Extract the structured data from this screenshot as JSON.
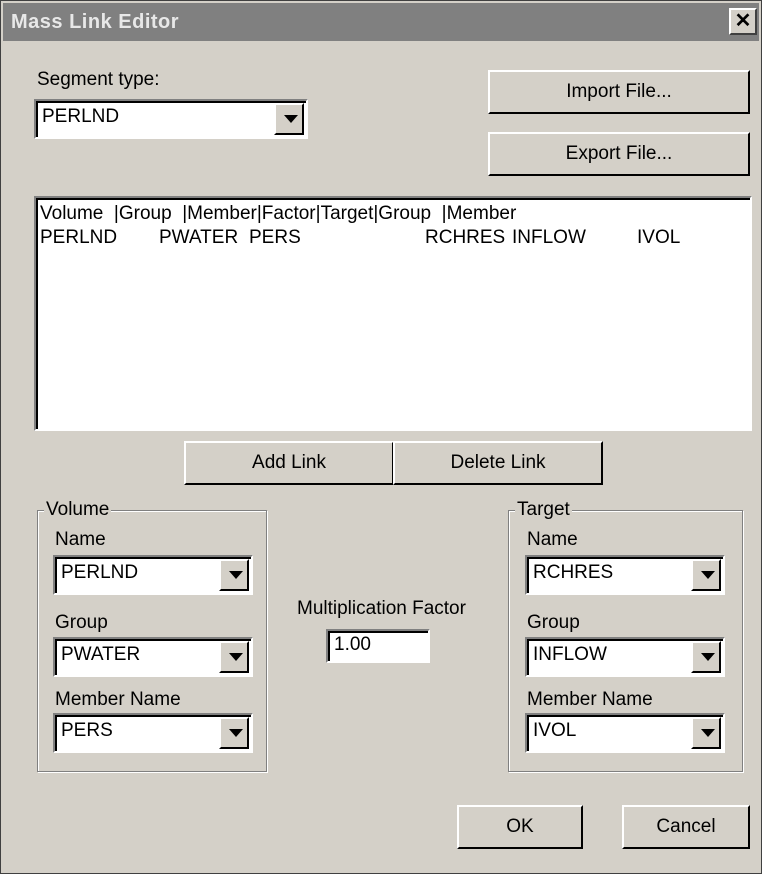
{
  "window": {
    "title": "Mass Link Editor",
    "close_glyph": "✕"
  },
  "segment": {
    "label": "Segment type:",
    "value": "PERLND"
  },
  "buttons": {
    "import": "Import File...",
    "export": "Export File...",
    "add_link": "Add Link",
    "delete_link": "Delete Link",
    "ok": "OK",
    "cancel": "Cancel"
  },
  "links_list": {
    "header": "Volume  |Group  |Member|Factor|Target|Group  |Member",
    "rows": [
      {
        "volume": "PERLND",
        "group": "PWATER",
        "member": "PERS",
        "factor": "",
        "target": "RCHRES",
        "target_group": "INFLOW",
        "target_member": "IVOL"
      }
    ]
  },
  "volume_group": {
    "title": "Volume",
    "name_label": "Name",
    "name_value": "PERLND",
    "group_label": "Group",
    "group_value": "PWATER",
    "member_label": "Member Name",
    "member_value": "PERS"
  },
  "multiplication": {
    "label": "Multiplication Factor",
    "value": "1.00"
  },
  "target_group": {
    "title": "Target",
    "name_label": "Name",
    "name_value": "RCHRES",
    "group_label": "Group",
    "group_value": "INFLOW",
    "member_label": "Member Name",
    "member_value": "IVOL"
  },
  "colors": {
    "dialog_bg": "#d4d0c8",
    "titlebar": "#808080"
  }
}
